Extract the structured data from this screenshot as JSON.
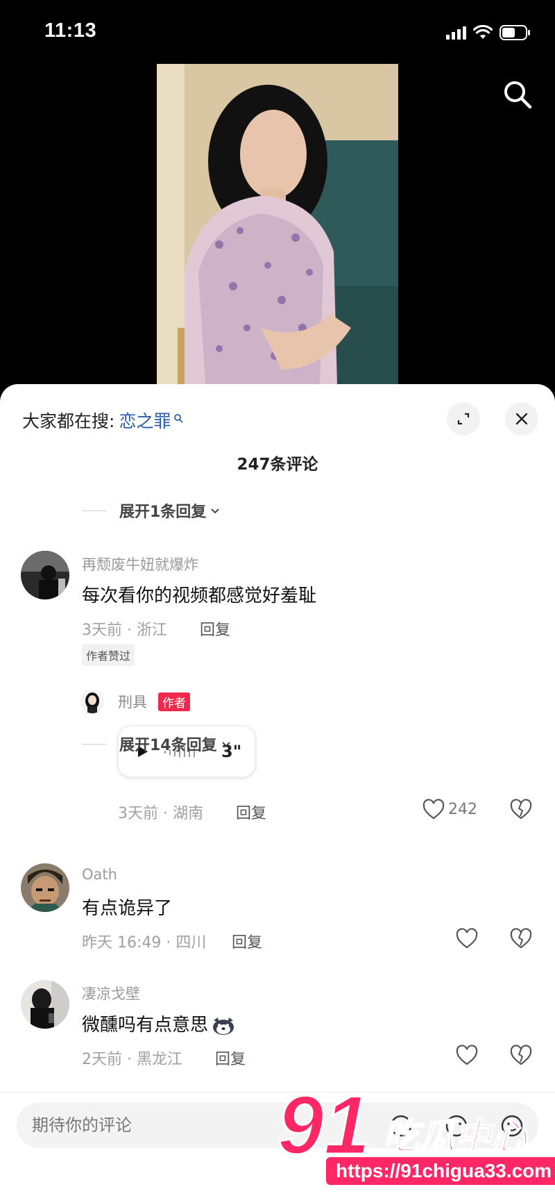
{
  "status_bar": {
    "time": "11:13",
    "icons": [
      "signal-icon",
      "wifi-icon",
      "battery-icon"
    ]
  },
  "video": {
    "description_icon": "video-thumbnail"
  },
  "header": {
    "hot_search_label": "大家都在搜:",
    "hot_search_keyword": "恋之罪",
    "comment_count": "247条评论"
  },
  "expand_first": {
    "label": "展开1条回复"
  },
  "comments": [
    {
      "username": "再颓废牛妞就爆炸",
      "content": "每次看你的视频都感觉好羞耻",
      "meta": "3天前 · 浙江",
      "reply": "回复",
      "badge": "作者赞过"
    },
    {
      "username": "Oath",
      "content": "有点诡异了",
      "meta": "昨天 16:49 · 四川",
      "reply": "回复"
    },
    {
      "username": "凄凉戈壁",
      "content": "微醺吗有点意思",
      "meta": "2天前 · 黑龙江",
      "reply": "回复"
    }
  ],
  "author_reply": {
    "username": "刑具",
    "tag": "作者",
    "voice_duration": "3\"",
    "meta": "3天前 · 湖南",
    "reply": "回复",
    "likes": "242"
  },
  "expand_second": {
    "label": "展开14条回复"
  },
  "input": {
    "placeholder": "期待你的评论"
  },
  "watermark": {
    "number": "91",
    "name": "吃瓜中心",
    "url": "https://91chigua33.com"
  },
  "colors": {
    "accent": "#ff2766",
    "link": "#2b5eaa",
    "author_tag": "#f0294c"
  }
}
